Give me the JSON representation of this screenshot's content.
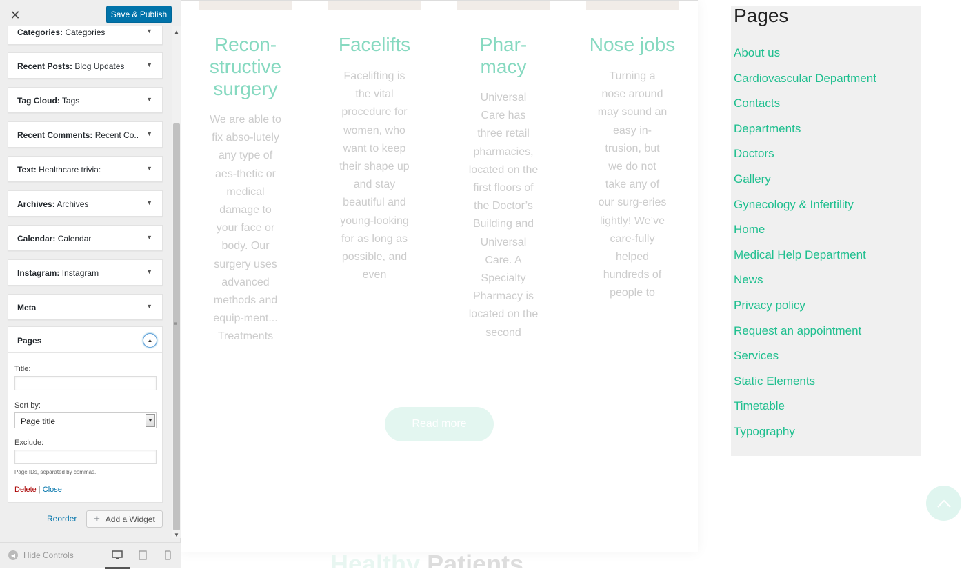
{
  "customizer": {
    "close_icon": "close-icon",
    "save_label": "Save & Publish",
    "widgets": [
      {
        "type": "Categories:",
        "title": "Categories"
      },
      {
        "type": "Recent Posts:",
        "title": "Blog Updates"
      },
      {
        "type": "Tag Cloud:",
        "title": "Tags"
      },
      {
        "type": "Recent Comments:",
        "title": "Recent Co..."
      },
      {
        "type": "Text:",
        "title": "Healthcare trivia:"
      },
      {
        "type": "Archives:",
        "title": "Archives"
      },
      {
        "type": "Calendar:",
        "title": "Calendar"
      },
      {
        "type": "Instagram:",
        "title": "Instagram"
      },
      {
        "type": "Meta",
        "title": ""
      }
    ],
    "pages_widget": {
      "name": "Pages",
      "title_label": "Title:",
      "title_value": "",
      "sort_label": "Sort by:",
      "sort_value": "Page title",
      "exclude_label": "Exclude:",
      "exclude_value": "",
      "hint": "Page IDs, separated by commas.",
      "delete_label": "Delete",
      "separator": "|",
      "close_label": "Close"
    },
    "reorder_label": "Reorder",
    "add_widget_label": "Add a Widget",
    "footer": {
      "hide_controls_label": "Hide Controls"
    }
  },
  "preview": {
    "services": [
      {
        "title": "Recon-\nstructive\nsurgery",
        "text": "We are able to fix abso-lutely any type of aes-thetic or medical damage to your face or body. Our surgery uses advanced methods and equip-ment... Treatments"
      },
      {
        "title": "Facelifts",
        "text": "Facelifting is the vital procedure for women, who want to keep their shape up and stay beautiful and young-looking for as long as possible, and even"
      },
      {
        "title": "Phar-\nmacy",
        "text": "Universal Care has three retail pharmacies, located on the first floors of the Doctor’s Building and Universal Care. A Specialty Pharmacy is located on the second"
      },
      {
        "title": "Nose jobs",
        "text": "Turning a nose around may sound an easy in-trusion, but we do not take any of our surg-eries lightly! We’ve care-fully helped hundreds of people to"
      }
    ],
    "read_more_label": "Read more",
    "bottom_heading_part1": "Healthy",
    "bottom_heading_part2": "Patients",
    "pages_heading": "Pages",
    "pages_links": [
      "About us",
      "Cardiovascular Department",
      "Contacts",
      "Departments",
      "Doctors",
      "Gallery",
      "Gynecology & Infertility",
      "Home",
      "Medical Help Department",
      "News",
      "Privacy policy",
      "Request an appointment",
      "Services",
      "Static Elements",
      "Timetable",
      "Typography"
    ]
  },
  "colors": {
    "accent_green": "#1fbf8f",
    "wp_blue": "#0073aa",
    "delete_red": "#a00"
  }
}
